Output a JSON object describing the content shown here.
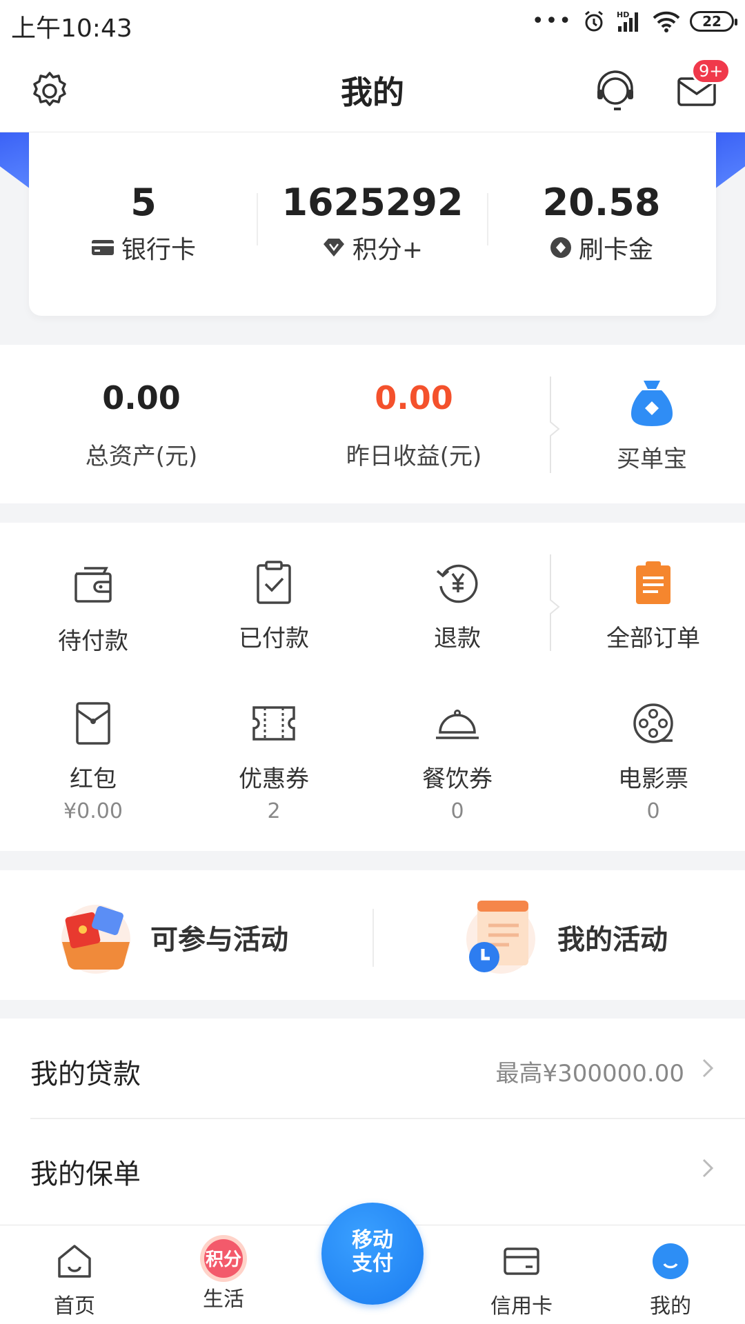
{
  "status_bar": {
    "time": "上午10:43",
    "battery": "22",
    "signal_label": "HD"
  },
  "header": {
    "title": "我的",
    "message_badge": "9+"
  },
  "stats": [
    {
      "value": "5",
      "label": "银行卡",
      "icon": "card-icon"
    },
    {
      "value": "1625292",
      "label": "积分+",
      "icon": "diamond-icon"
    },
    {
      "value": "20.58",
      "label": "刷卡金",
      "icon": "coin-icon"
    }
  ],
  "assets": {
    "total": {
      "value": "0.00",
      "label": "总资产(元)"
    },
    "yesterday": {
      "value": "0.00",
      "label": "昨日收益(元)",
      "color": "#f4512c"
    },
    "maidanbao": {
      "label": "买单宝"
    }
  },
  "orders": {
    "pending": "待付款",
    "paid": "已付款",
    "refund": "退款",
    "all": "全部订单"
  },
  "coupons": [
    {
      "label": "红包",
      "value": "¥0.00"
    },
    {
      "label": "优惠券",
      "value": "2"
    },
    {
      "label": "餐饮券",
      "value": "0"
    },
    {
      "label": "电影票",
      "value": "0"
    }
  ],
  "activities": {
    "available": "可参与活动",
    "mine": "我的活动"
  },
  "list": [
    {
      "label": "我的贷款",
      "value": "最高¥300000.00"
    },
    {
      "label": "我的保单",
      "value": ""
    }
  ],
  "tabbar": {
    "home": "首页",
    "life": "生活",
    "life_badge": "积分",
    "pay_line1": "移动",
    "pay_line2": "支付",
    "credit": "信用卡",
    "mine": "我的"
  },
  "colors": {
    "accent_blue": "#1a7bf0",
    "orange": "#f5862e",
    "red": "#f4512c"
  }
}
